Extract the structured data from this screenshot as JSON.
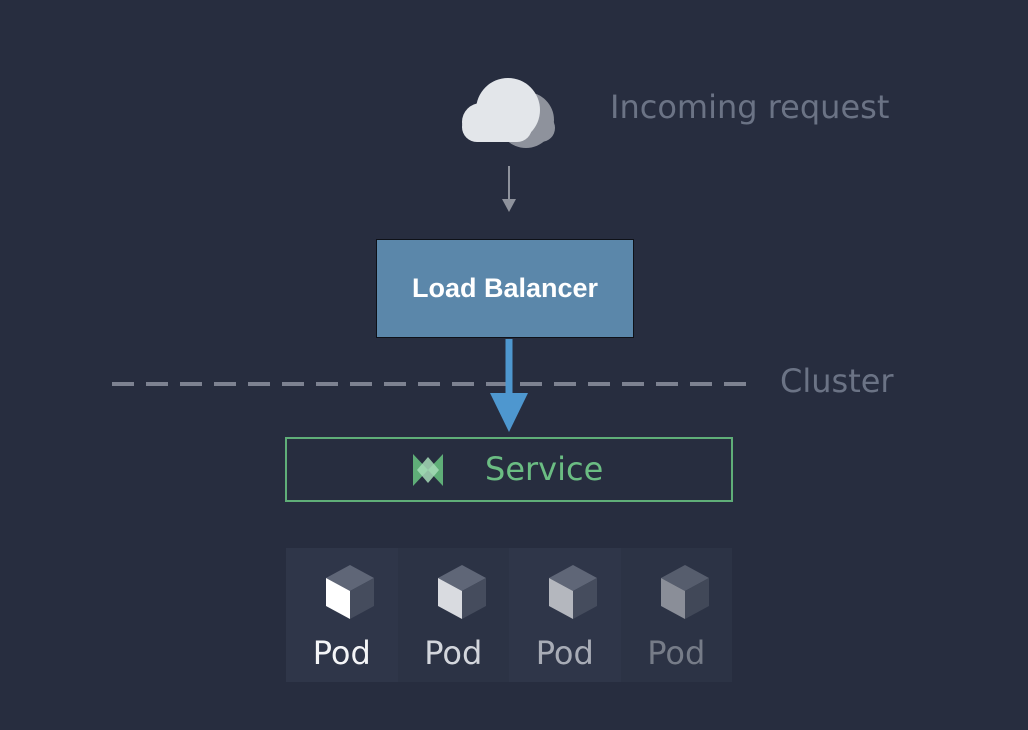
{
  "incoming": {
    "label": "Incoming request",
    "icon": "cloud-icon"
  },
  "load_balancer": {
    "label": "Load Balancer",
    "color": "#5b87aa"
  },
  "cluster": {
    "label": "Cluster"
  },
  "service": {
    "label": "Service",
    "icon": "service-bowtie-icon",
    "color": "#5fae78"
  },
  "pods": [
    {
      "label": "Pod"
    },
    {
      "label": "Pod"
    },
    {
      "label": "Pod"
    },
    {
      "label": "Pod"
    }
  ],
  "colors": {
    "background": "#272d3f",
    "muted_text": "#6b7385",
    "arrow": "#4e97cf",
    "dashed_line": "#7d8291"
  }
}
